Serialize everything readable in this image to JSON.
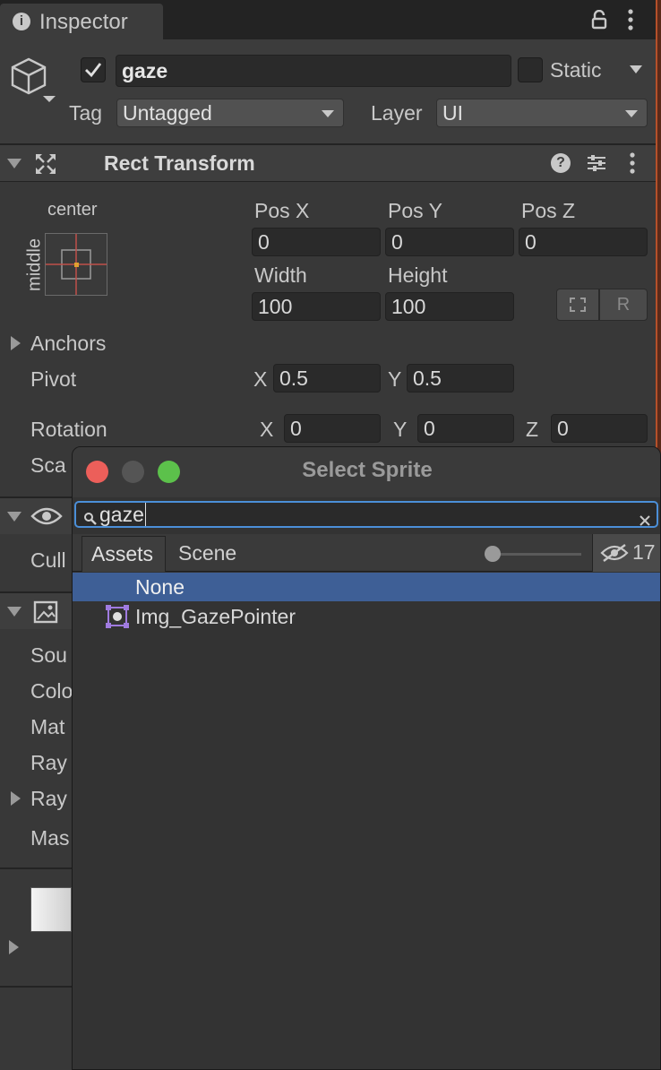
{
  "inspector": {
    "tab_title": "Inspector",
    "gameobject": {
      "name": "gaze",
      "static_label": "Static",
      "tag_label": "Tag",
      "tag_value": "Untagged",
      "layer_label": "Layer",
      "layer_value": "UI"
    },
    "rect_transform": {
      "title": "Rect Transform",
      "anchor_h": "center",
      "anchor_v": "middle",
      "pos_x_label": "Pos X",
      "pos_y_label": "Pos Y",
      "pos_z_label": "Pos Z",
      "pos_x": "0",
      "pos_y": "0",
      "pos_z": "0",
      "width_label": "Width",
      "height_label": "Height",
      "width": "100",
      "height": "100",
      "raw_button": "R",
      "anchors_label": "Anchors",
      "pivot_label": "Pivot",
      "pivot_x_label": "X",
      "pivot_x": "0.5",
      "pivot_y_label": "Y",
      "pivot_y": "0.5",
      "rotation_label": "Rotation",
      "rot_x_label": "X",
      "rot_x": "0",
      "rot_y_label": "Y",
      "rot_y": "0",
      "rot_z_label": "Z",
      "rot_z": "0",
      "scale_label_partial": "Sca"
    },
    "partial_labels": {
      "cull": "Cull",
      "source": "Sou",
      "color": "Colo",
      "material": "Mat",
      "raycast": "Ray",
      "raycast2": "Ray",
      "mask": "Mas"
    }
  },
  "select_sprite": {
    "title": "Select Sprite",
    "search_value": "gaze",
    "tabs": [
      "Assets",
      "Scene"
    ],
    "hidden_count": "17",
    "items": [
      {
        "label": "None",
        "selected": true
      },
      {
        "label": "Img_GazePointer",
        "selected": false
      }
    ]
  },
  "colors": {
    "accent_selected": "#3e5f96",
    "search_focus": "#4b8fd8",
    "close_red": "#ec5f5a",
    "zoom_green": "#5cc14b"
  }
}
